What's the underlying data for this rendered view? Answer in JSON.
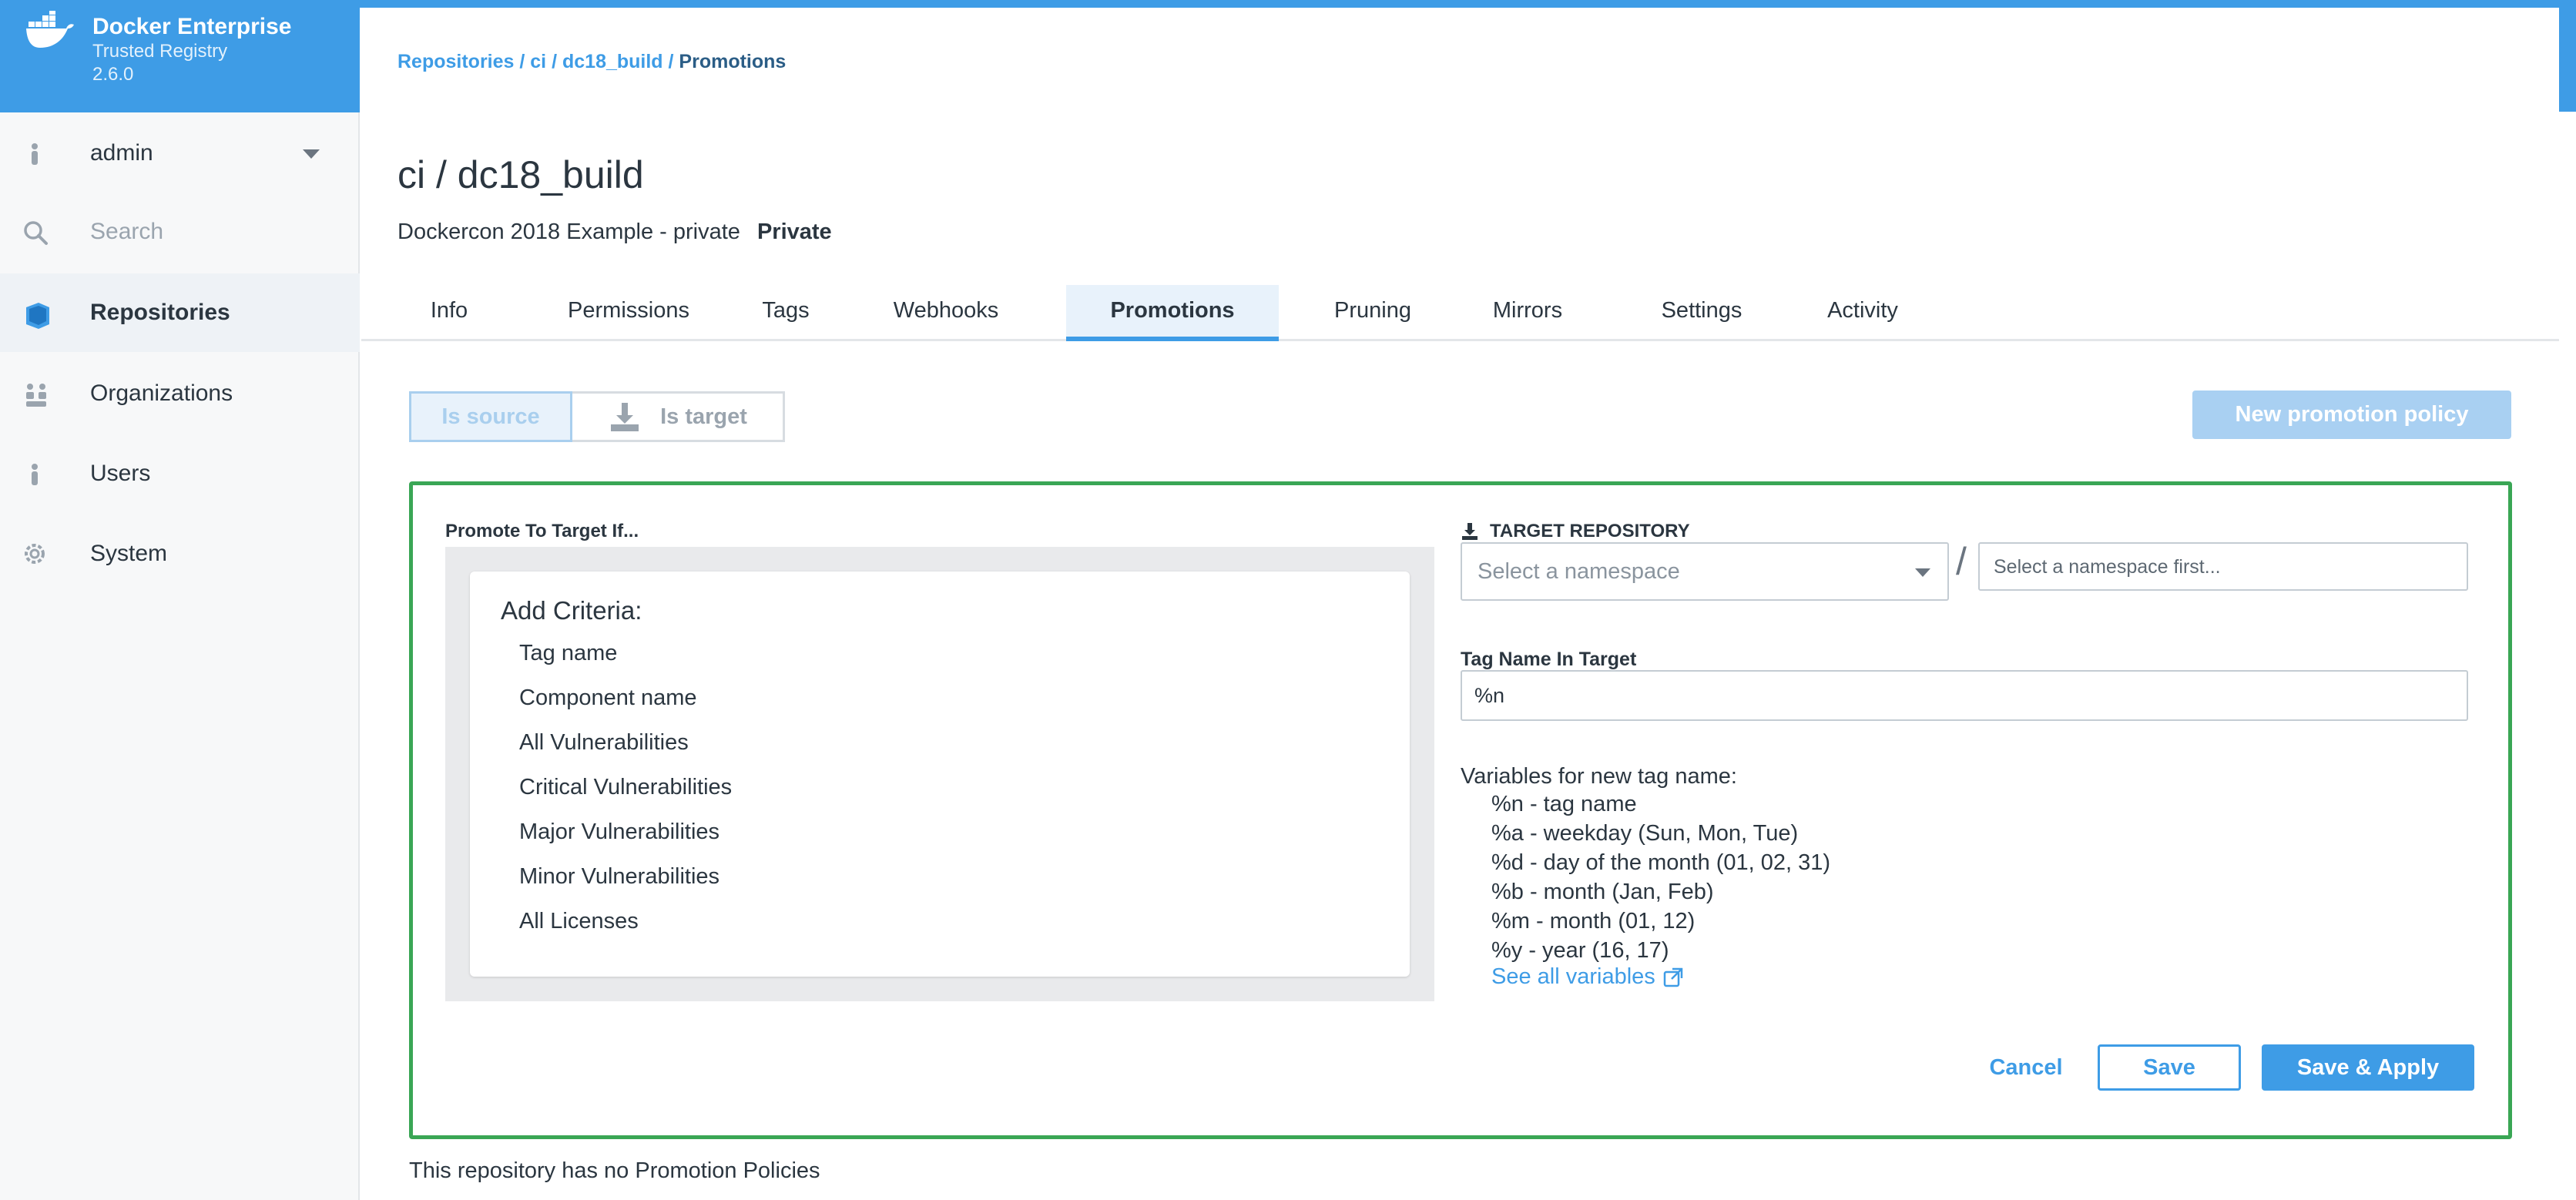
{
  "brand": {
    "title": "Docker Enterprise",
    "subtitle": "Trusted Registry",
    "version": "2.6.0",
    "color": "#3e9ce6"
  },
  "sidebar": {
    "user": {
      "label": "admin",
      "icon": "user-icon"
    },
    "search": {
      "label": "Search",
      "icon": "search-icon"
    },
    "items": [
      {
        "label": "Repositories",
        "icon": "book-icon",
        "active": true
      },
      {
        "label": "Organizations",
        "icon": "organizations-icon",
        "active": false
      },
      {
        "label": "Users",
        "icon": "user-icon",
        "active": false
      },
      {
        "label": "System",
        "icon": "gear-icon",
        "active": false
      }
    ]
  },
  "breadcrumb": {
    "parts": [
      "Repositories",
      "ci",
      "dc18_build"
    ],
    "current": "Promotions",
    "separator": " / "
  },
  "page": {
    "title": "ci / dc18_build",
    "description": "Dockercon 2018 Example - private",
    "visibility": "Private"
  },
  "tabs": [
    "Info",
    "Permissions",
    "Tags",
    "Webhooks",
    "Promotions",
    "Pruning",
    "Mirrors",
    "Settings",
    "Activity"
  ],
  "active_tab": "Promotions",
  "toggle": {
    "source_label": "Is source",
    "target_label": "Is target",
    "selected": "Is source"
  },
  "new_policy_label": "New promotion policy",
  "policy_form": {
    "promote_label": "Promote To Target If...",
    "criteria_title": "Add Criteria:",
    "criteria": [
      "Tag name",
      "Component name",
      "All Vulnerabilities",
      "Critical Vulnerabilities",
      "Major Vulnerabilities",
      "Minor Vulnerabilities",
      "All Licenses"
    ],
    "target_repo_label": "TARGET REPOSITORY",
    "namespace_placeholder": "Select a namespace",
    "slash": "/",
    "repo_placeholder": "Select a namespace first...",
    "tag_name_label": "Tag Name In Target",
    "tag_name_value": "%n",
    "variables_title": "Variables for new tag name:",
    "variables": [
      "%n - tag name",
      "%a - weekday (Sun, Mon, Tue)",
      "%d - day of the month (01, 02, 31)",
      "%b - month (Jan, Feb)",
      "%m - month (01, 12)",
      "%y - year (16, 17)"
    ],
    "see_all_label": "See all variables",
    "cancel_label": "Cancel",
    "save_label": "Save",
    "save_apply_label": "Save & Apply",
    "border_color": "#3aa655"
  },
  "empty_message": "This repository has no Promotion Policies"
}
